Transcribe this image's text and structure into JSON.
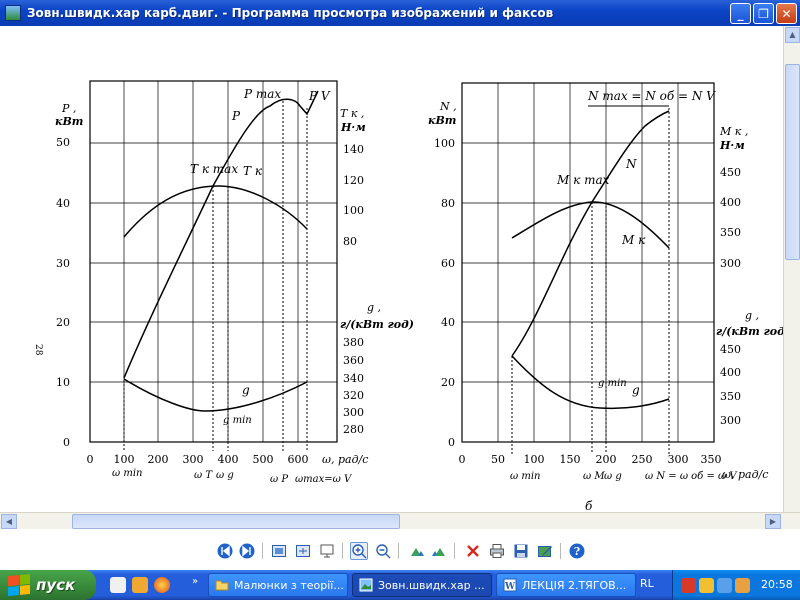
{
  "window": {
    "title": "Зовн.швидк.хар карб.двиг. - Программа просмотра изображений и факсов",
    "minimize": "_",
    "maximize": "❐",
    "close": "✕"
  },
  "figure": {
    "left": {
      "title_p": "P ,",
      "unit_p": "кВт",
      "title_tk": "T к ,",
      "unit_tk": "Н·м",
      "title_g": "g ,",
      "unit_g": "г/(кВт год)",
      "x_label": "ω, рад/с",
      "p_ticks": [
        "0",
        "10",
        "20",
        "30",
        "40",
        "50"
      ],
      "tk_ticks": [
        "80",
        "100",
        "120",
        "140"
      ],
      "g_ticks": [
        "280",
        "300",
        "320",
        "340",
        "360",
        "380"
      ],
      "x_ticks": [
        "0",
        "100",
        "200",
        "300",
        "400",
        "500",
        "600"
      ],
      "curve_labels": {
        "pmax": "P max",
        "p": "P",
        "pv": "P V",
        "tkmax": "T к max",
        "tk": "T к",
        "g": "g",
        "gmin": "g min"
      },
      "omega_labels": {
        "min": "ω min",
        "t": "ω T",
        "g": "ω g",
        "p": "ω P",
        "max": "ωmax=ω V"
      },
      "page_number": "28"
    },
    "right": {
      "title_n": "N ,",
      "unit_n": "кВт",
      "title_mk": "M к ,",
      "unit_mk": "Н·м",
      "title_g": "g ,",
      "unit_g": "г/(кВт год)",
      "x_label": "ω, рад/с",
      "n_ticks": [
        "0",
        "20",
        "40",
        "60",
        "80",
        "100"
      ],
      "mk_ticks": [
        "300",
        "350",
        "400",
        "450"
      ],
      "g_ticks": [
        "300",
        "350",
        "400",
        "450"
      ],
      "x_ticks": [
        "0",
        "50",
        "100",
        "150",
        "200",
        "250",
        "300",
        "350"
      ],
      "top_label": "N max = N об = N V",
      "curve_labels": {
        "mkmax": "M к max",
        "n": "N",
        "mk": "M к",
        "gmin": "g min",
        "g": "g"
      },
      "omega_labels": {
        "min": "ω min",
        "m": "ω M",
        "g": "ω g",
        "n": "ω N = ω об = ω V"
      },
      "sub_label": "б"
    }
  },
  "toolbar": {
    "buttons": [
      {
        "name": "previous-image-button",
        "icon": "prev-icon"
      },
      {
        "name": "next-image-button",
        "icon": "next-icon"
      },
      {
        "name": "best-fit-button",
        "icon": "best-fit-icon"
      },
      {
        "name": "actual-size-button",
        "icon": "actual-size-icon"
      },
      {
        "name": "slideshow-button",
        "icon": "slideshow-icon"
      },
      {
        "name": "zoom-in-button",
        "icon": "zoom-in-icon"
      },
      {
        "name": "zoom-out-button",
        "icon": "zoom-out-icon"
      },
      {
        "name": "rotate-clockwise-button",
        "icon": "rotate-cw-icon"
      },
      {
        "name": "rotate-counterclockwise-button",
        "icon": "rotate-ccw-icon"
      },
      {
        "name": "delete-button",
        "icon": "delete-icon"
      },
      {
        "name": "print-button",
        "icon": "print-icon"
      },
      {
        "name": "save-button",
        "icon": "save-icon"
      },
      {
        "name": "edit-button",
        "icon": "edit-icon"
      },
      {
        "name": "help-button",
        "icon": "help-icon"
      }
    ]
  },
  "taskbar": {
    "start_label": "пуск",
    "more": "»",
    "tasks": [
      {
        "label": "Малюнки з теорії...",
        "icon": "folder-icon",
        "active": false
      },
      {
        "label": "Зовн.швидк.хар ...",
        "icon": "image-viewer-icon",
        "active": true
      },
      {
        "label": "ЛЕКЦІЯ 2.ТЯГОВ...",
        "icon": "word-document-icon",
        "active": false
      }
    ],
    "language": "RL",
    "clock": "20:58"
  },
  "colors": {
    "titlebar": "#0b44c6",
    "taskbar": "#245edb",
    "start_button": "#37883a",
    "close_button": "#c43d14"
  }
}
